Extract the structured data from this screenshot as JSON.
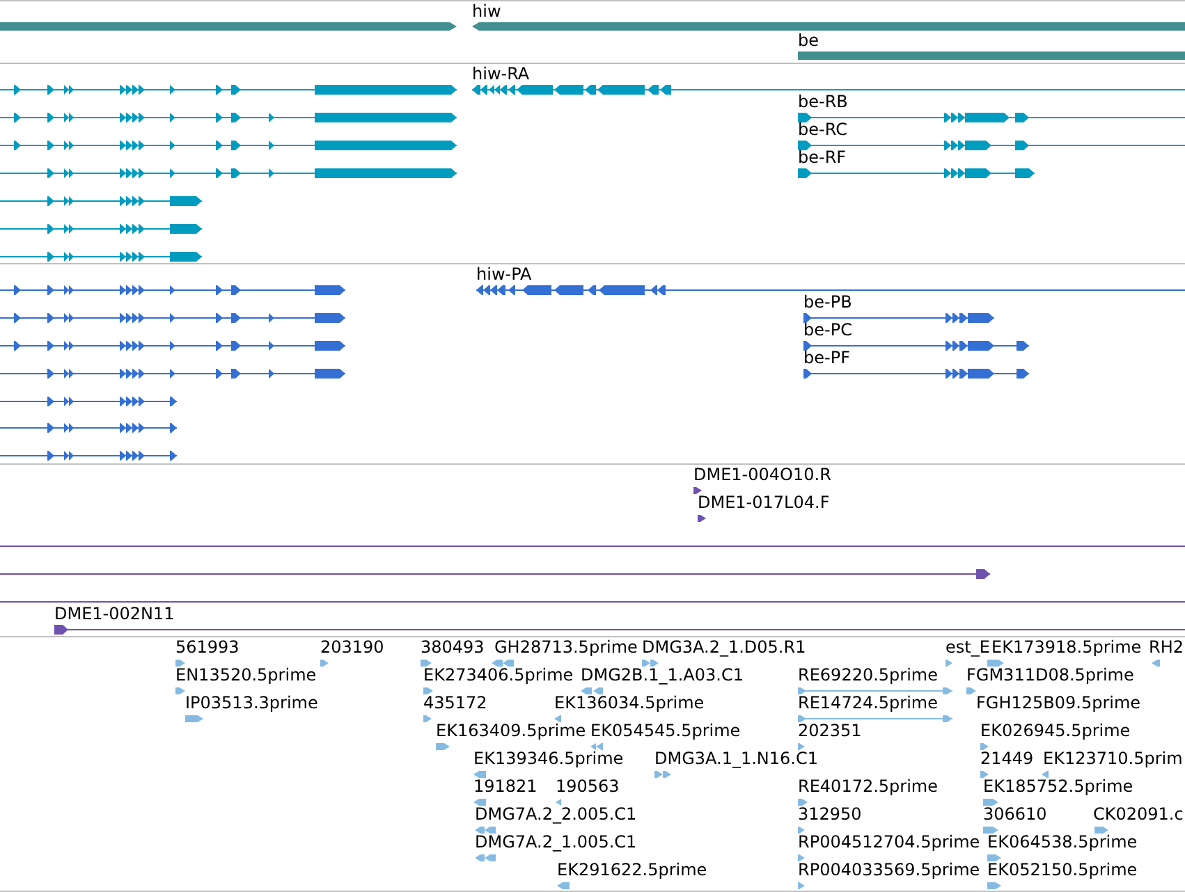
{
  "tracks": [
    {
      "kind": "gene",
      "features": [
        {
          "reverse": false
        },
        {
          "label": "hiw",
          "reverse": true
        },
        {
          "label": "be",
          "reverse": false
        }
      ]
    },
    {
      "kind": "transcript",
      "features": [
        {
          "reverse": false
        },
        {
          "reverse": false
        },
        {
          "reverse": false
        },
        {
          "reverse": false
        },
        {
          "reverse": false
        },
        {
          "reverse": false
        },
        {
          "reverse": false
        },
        {
          "label": "hiw-RA",
          "reverse": true
        },
        {
          "label": "be-RB",
          "reverse": false
        },
        {
          "label": "be-RC",
          "reverse": false
        },
        {
          "label": "be-RF",
          "reverse": false
        }
      ]
    },
    {
      "kind": "protein",
      "features": [
        {
          "reverse": false
        },
        {
          "reverse": false
        },
        {
          "reverse": false
        },
        {
          "reverse": false
        },
        {
          "reverse": false
        },
        {
          "reverse": false
        },
        {
          "reverse": false
        },
        {
          "label": "hiw-PA",
          "reverse": true
        },
        {
          "label": "be-PB",
          "reverse": false
        },
        {
          "label": "be-PC",
          "reverse": false
        },
        {
          "label": "be-PF",
          "reverse": false
        }
      ]
    },
    {
      "kind": "clone",
      "features": [
        {
          "kind": "read",
          "label": "DME1-004O10.R",
          "reverse": false
        },
        {
          "kind": "read",
          "label": "DME1-017L04.F",
          "reverse": false
        },
        {
          "kind": "span"
        },
        {
          "kind": "segment",
          "reverse": false
        },
        {
          "kind": "span"
        },
        {
          "kind": "segment",
          "label": "DME1-002N11",
          "reverse": false
        }
      ]
    },
    {
      "kind": "est",
      "features": [
        {
          "label": "561993",
          "reverse": false
        },
        {
          "label": "203190",
          "reverse": false
        },
        {
          "label": "380493",
          "reverse": false
        },
        {
          "label": "GH28713.5prime",
          "reverse": true
        },
        {
          "label": "DMG3A.2_1.D05.R1",
          "reverse": false
        },
        {
          "label": "est_E",
          "reverse": false
        },
        {
          "label": "EK173918.5prime",
          "reverse": false
        },
        {
          "label": "RH2",
          "reverse": true
        },
        {
          "label": "EN13520.5prime",
          "reverse": false
        },
        {
          "label": "EK273406.5prime",
          "reverse": false
        },
        {
          "label": "DMG2B.1_1.A03.C1",
          "reverse": true
        },
        {
          "label": "RE69220.5prime",
          "reverse": false
        },
        {
          "label": "FGM311D08.5prime",
          "reverse": false
        },
        {
          "label": "IP03513.3prime",
          "reverse": false
        },
        {
          "label": "435172",
          "reverse": false
        },
        {
          "label": "EK136034.5prime",
          "reverse": true
        },
        {
          "label": "RE14724.5prime",
          "reverse": false
        },
        {
          "label": "FGH125B09.5prime"
        },
        {
          "label": "EK163409.5prime",
          "reverse": false
        },
        {
          "label": "EK054545.5prime",
          "reverse": true
        },
        {
          "label": "202351",
          "reverse": false
        },
        {
          "label": "EK026945.5prime",
          "reverse": false
        },
        {
          "label": "EK139346.5prime",
          "reverse": true
        },
        {
          "label": "DMG3A.1_1.N16.C1",
          "reverse": false
        },
        {
          "label": "21449",
          "reverse": false
        },
        {
          "label": "EK123710.5prim",
          "reverse": true
        },
        {
          "label": "191821",
          "reverse": true
        },
        {
          "label": "190563",
          "reverse": true
        },
        {
          "label": "RE40172.5prime",
          "reverse": false
        },
        {
          "label": "EK185752.5prime",
          "reverse": false
        },
        {
          "label": "DMG7A.2_2.005.C1",
          "reverse": true
        },
        {
          "label": "312950",
          "reverse": false
        },
        {
          "label": "306610",
          "reverse": false
        },
        {
          "label": "CK02091.c",
          "reverse": false
        },
        {
          "label": "DMG7A.2_1.005.C1",
          "reverse": true
        },
        {
          "label": "RP004512704.5prime",
          "reverse": false
        },
        {
          "label": "EK064538.5prime",
          "reverse": false
        },
        {
          "label": "EK291622.5prime",
          "reverse": true
        },
        {
          "label": "RP004033569.5prime",
          "reverse": false
        },
        {
          "label": "EK052150.5prime",
          "reverse": false
        }
      ]
    }
  ]
}
